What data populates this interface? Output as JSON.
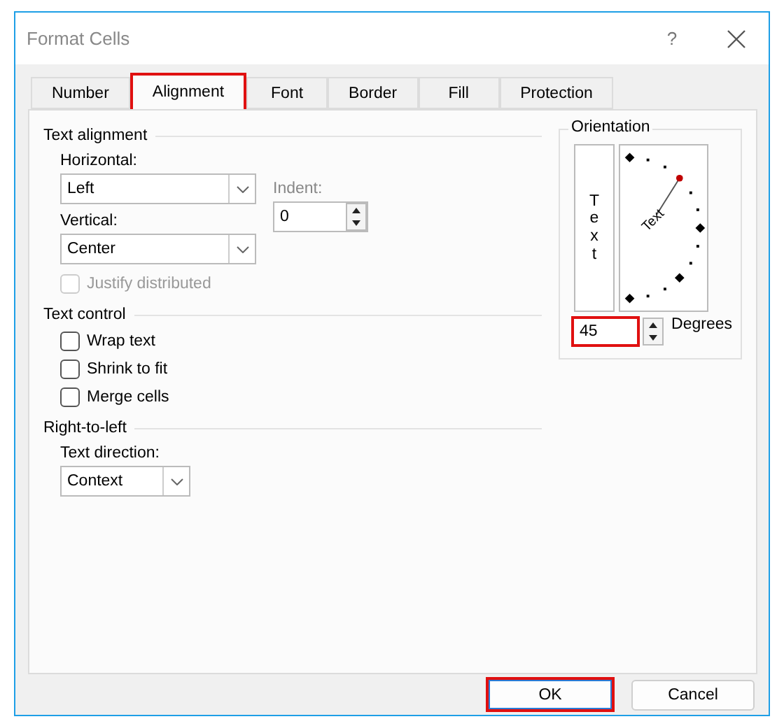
{
  "window": {
    "title": "Format Cells",
    "help": "?"
  },
  "tabs": [
    {
      "label": "Number",
      "selected": false,
      "highlighted": false
    },
    {
      "label": "Alignment",
      "selected": true,
      "highlighted": true
    },
    {
      "label": "Font",
      "selected": false,
      "highlighted": false
    },
    {
      "label": "Border",
      "selected": false,
      "highlighted": false
    },
    {
      "label": "Fill",
      "selected": false,
      "highlighted": false
    },
    {
      "label": "Protection",
      "selected": false,
      "highlighted": false
    }
  ],
  "text_alignment": {
    "title": "Text alignment",
    "horizontal": {
      "label": "Horizontal:",
      "value": "Left"
    },
    "indent": {
      "label": "Indent:",
      "value": "0",
      "disabled": true
    },
    "vertical": {
      "label": "Vertical:",
      "value": "Center"
    },
    "justify_distributed": {
      "label": "Justify distributed",
      "checked": false,
      "disabled": true
    }
  },
  "text_control": {
    "title": "Text control",
    "options": [
      {
        "label": "Wrap text",
        "checked": false
      },
      {
        "label": "Shrink to fit",
        "checked": false
      },
      {
        "label": "Merge cells",
        "checked": false
      }
    ]
  },
  "right_to_left": {
    "title": "Right-to-left",
    "text_direction": {
      "label": "Text direction:",
      "value": "Context"
    }
  },
  "orientation": {
    "title": "Orientation",
    "vertical_text": "Text",
    "rotated_text": "Text",
    "degrees": {
      "value": "45",
      "label": "Degrees",
      "highlighted": true
    }
  },
  "buttons": [
    {
      "label": "OK",
      "default": true,
      "highlighted": true
    },
    {
      "label": "Cancel",
      "default": false,
      "highlighted": false
    }
  ]
}
